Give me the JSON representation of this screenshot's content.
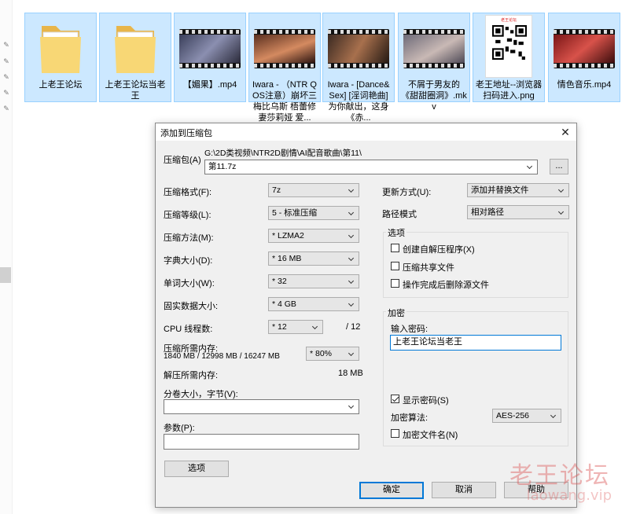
{
  "explorer": {
    "files": [
      {
        "name": "上老王论坛",
        "type": "folder"
      },
      {
        "name": "上老王论坛当老王",
        "type": "folder"
      },
      {
        "name": "【媚果】.mp4",
        "type": "video"
      },
      {
        "name": "Iwara - （NTR QOS注意）崩坏三 梅比乌斯 梧蕾修 妻莎莉娅 爱...",
        "type": "video"
      },
      {
        "name": "Iwara - [Dance&Sex] [淫词艳曲] 为你献出，这身《赤...",
        "type": "video"
      },
      {
        "name": "不屑于男友的《甜甜圈洞》.mkv",
        "type": "video"
      },
      {
        "name": "老王地址--浏览器扫码进入.png",
        "type": "image",
        "card_title": "老王论坛"
      },
      {
        "name": "情色音乐.mp4",
        "type": "video"
      }
    ]
  },
  "dialog": {
    "title": "添加到压缩包",
    "close_icon": "close-icon",
    "archive_label": "压缩包(A)",
    "archive_path": "G:\\2D类视频\\NTR2D剧情\\AI配音歌曲\\第11\\",
    "archive_name": "第11.7z",
    "browse_label": "...",
    "format_label": "压缩格式(F):",
    "format_value": "7z",
    "level_label": "压缩等级(L):",
    "level_value": "5 - 标准压缩",
    "method_label": "压缩方法(M):",
    "method_value": "* LZMA2",
    "dict_label": "字典大小(D):",
    "dict_value": "* 16 MB",
    "word_label": "单词大小(W):",
    "word_value": "* 32",
    "solid_label": "固实数据大小:",
    "solid_value": "* 4 GB",
    "cpu_label": "CPU 线程数:",
    "cpu_value": "* 12",
    "cpu_total": "/ 12",
    "mem_comp_label": "压缩所需内存:",
    "mem_comp_detail": "1840 MB / 12998 MB / 16247 MB",
    "mem_percent": "* 80%",
    "mem_decomp_label": "解压所需内存:",
    "mem_decomp_value": "18 MB",
    "split_label": "分卷大小，字节(V):",
    "split_value": "",
    "params_label": "参数(P):",
    "params_value": "",
    "options_button": "选项",
    "update_label": "更新方式(U):",
    "update_value": "添加并替换文件",
    "path_label": "路径模式",
    "path_value": "相对路径",
    "options_group": "选项",
    "opt_sfx": "创建自解压程序(X)",
    "opt_shared": "压缩共享文件",
    "opt_delete": "操作完成后删除源文件",
    "encrypt_group": "加密",
    "password_label": "输入密码:",
    "password_value": "上老王论坛当老王",
    "show_password": "显示密码(S)",
    "enc_method_label": "加密算法:",
    "enc_method_value": "AES-256",
    "enc_names": "加密文件名(N)",
    "ok": "确定",
    "cancel": "取消",
    "help": "帮助"
  },
  "watermark": {
    "cn": "老王论坛",
    "url": "laowang.vip"
  }
}
